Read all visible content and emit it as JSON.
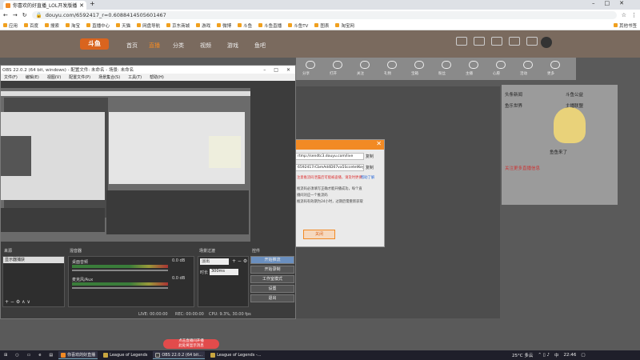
{
  "browser": {
    "tab_title": "你喜欢的好直播_LOL开发版播",
    "url": "douyu.com/6592417_r=0.6088414505601467",
    "bookmarks": [
      "应用",
      "百度",
      "搜索",
      "淘宝",
      "直播中心",
      "天猫",
      "网盘导航",
      "京东商城",
      "游戏",
      "微博",
      "斗鱼",
      "斗鱼直播",
      "斗鱼TV",
      "图表",
      "淘宝网",
      "更多书签"
    ],
    "other_bookmarks": "其他书签"
  },
  "douyu": {
    "logo": "斗鱼",
    "nav": [
      "首页",
      "直播",
      "分类",
      "视频",
      "游戏",
      "鱼吧"
    ],
    "toolbar": [
      "分享",
      "打开",
      "关注",
      "礼物",
      "宝箱",
      "粉丝",
      "主播",
      "心愿",
      "活动",
      "更多"
    ],
    "right_panel": {
      "items": [
        "头条新闻",
        "斗鱼公益",
        "鱼乐世界",
        "主播联盟"
      ],
      "caption": "鱼鱼来了",
      "notice": "关注更多直播信息"
    }
  },
  "dialog": {
    "title": "",
    "url_field": "rtmp://sendtc3.douyu.com/live",
    "key_field": "6592417rCbmAd4D07va5SccetetKey",
    "copy1": "复制",
    "copy2": "复制",
    "warning": "注意推流码泄露后可能被盗播，请及时更换",
    "help": "帮助了解",
    "text1": "推流码必须填写正确才能开播成功，每个直",
    "text2": "播间对应一个推流码",
    "text3": "推流码有效期为24小时，过期后需重新获取",
    "button": "关闭"
  },
  "obs": {
    "title": "OBS 22.0.2 (64 bit, windows) - 配置文件: 未命名 - 场景: 未命名",
    "menu": [
      "文件(F)",
      "编辑(E)",
      "视图(V)",
      "配置文件(P)",
      "场景集合(S)",
      "工具(T)",
      "帮助(H)"
    ],
    "panels": {
      "scenes": "来源",
      "mixer": "混音器",
      "transitions": "场景过渡",
      "controls": "控件"
    },
    "source_item": "显示器捕获",
    "mixer": [
      {
        "name": "桌面音频",
        "db": "0.0 dB"
      },
      {
        "name": "麦克风/Aux",
        "db": "0.0 dB"
      }
    ],
    "transition": {
      "type": "淡出",
      "duration_label": "时长",
      "duration": "300ms"
    },
    "buttons": [
      "开始推流",
      "开始录制",
      "工作室模式",
      "设置",
      "退出"
    ],
    "status": {
      "live": "LIVE: 00:00:00",
      "rec": "REC: 00:00:00",
      "cpu": "CPU: 9.3%, 30.00 fps"
    }
  },
  "taskbar": {
    "apps": [
      "你喜欢的好直播",
      "League of Legends",
      "OBS 22.0.2 (64 bit...",
      "League of Legends -..."
    ],
    "weather": "25°C 多云",
    "ime": "中",
    "time": "22:46"
  },
  "toast": {
    "line1": "点击直播间开播",
    "line2": "此处将显示消息"
  }
}
